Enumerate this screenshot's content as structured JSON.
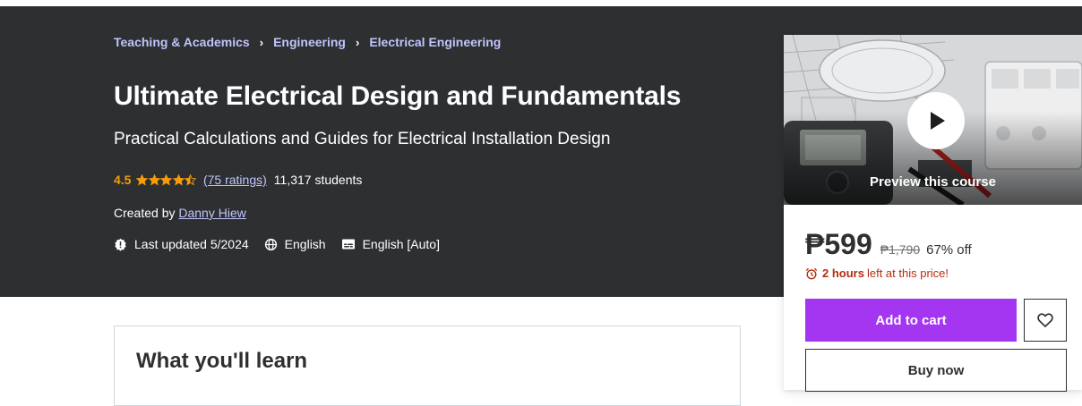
{
  "breadcrumb": {
    "items": [
      "Teaching & Academics",
      "Engineering",
      "Electrical Engineering"
    ],
    "separator": "›"
  },
  "course": {
    "title": "Ultimate Electrical Design and Fundamentals",
    "subtitle": "Practical Calculations and Guides for Electrical Installation Design",
    "rating": "4.5",
    "rating_value": 4.5,
    "ratings_link": "(75 ratings)",
    "students": "11,317 students",
    "created_by_label": "Created by",
    "instructor": "Danny Hiew",
    "last_updated": "Last updated 5/2024",
    "language": "English",
    "captions": "English [Auto]"
  },
  "learn": {
    "title": "What you'll learn"
  },
  "sidebar": {
    "preview_label": "Preview this course",
    "price": "₱599",
    "original_price": "₱1,790",
    "discount": "67% off",
    "timer_bold": "2 hours",
    "timer_rest": "left at this price!",
    "add_to_cart": "Add to cart",
    "buy_now": "Buy now"
  },
  "colors": {
    "hero_bg": "#2d2f31",
    "link": "#c0c4fc",
    "star": "#f69c08",
    "accent": "#a435f0",
    "timer": "#b32d0f"
  },
  "icons": [
    "alert-badge-icon",
    "globe-icon",
    "captions-icon",
    "chevron-right-icon",
    "star-icon",
    "play-icon",
    "alarm-icon",
    "heart-icon"
  ]
}
